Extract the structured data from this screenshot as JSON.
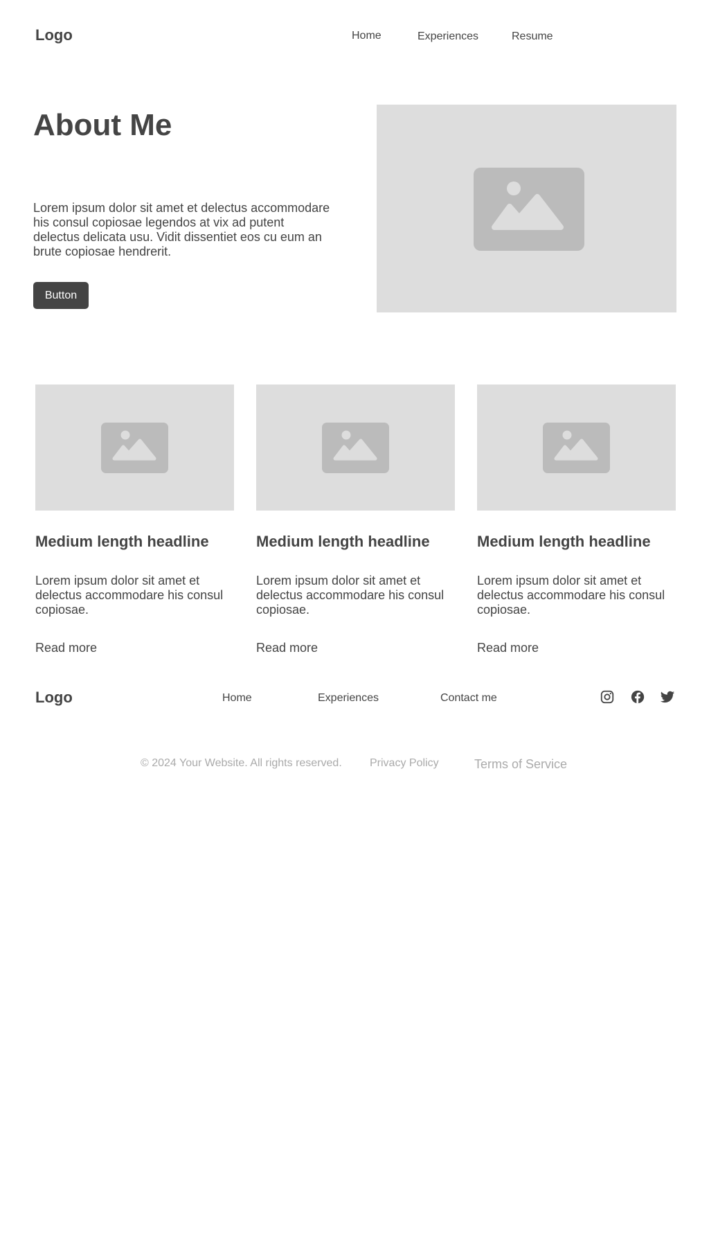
{
  "header": {
    "logo": "Logo",
    "nav": [
      "Home",
      "Experiences",
      "Resume"
    ]
  },
  "hero": {
    "title": "About Me",
    "text": "Lorem ipsum dolor sit amet et delectus accommodare his consul copiosae legendos at vix ad putent delectus delicata usu. Vidit dissentiet eos cu eum an brute copiosae hendrerit.",
    "button_label": "Button",
    "image_icon": "image-placeholder-icon"
  },
  "cards": [
    {
      "title": "Medium length headline",
      "text": "Lorem ipsum dolor sit amet et delectus accommodare his consul copiosae.",
      "link": "Read more"
    },
    {
      "title": "Medium length headline",
      "text": "Lorem ipsum dolor sit amet et delectus accommodare his consul copiosae.",
      "link": "Read more"
    },
    {
      "title": "Medium length headline",
      "text": "Lorem ipsum dolor sit amet et delectus accommodare his consul copiosae.",
      "link": "Read more"
    }
  ],
  "footer": {
    "logo": "Logo",
    "nav": [
      "Home",
      "Experiences",
      "Contact me"
    ],
    "social_icons": [
      "instagram-icon",
      "facebook-icon",
      "twitter-icon"
    ],
    "copyright": "© 2024 Your Website. All rights reserved.",
    "privacy": "Privacy Policy",
    "terms": "Terms of Service"
  },
  "colors": {
    "text": "#444444",
    "placeholder_bg": "#dddddd",
    "placeholder_icon": "#bbbbbb",
    "button_bg": "#444444",
    "muted": "#aaaaaa"
  }
}
